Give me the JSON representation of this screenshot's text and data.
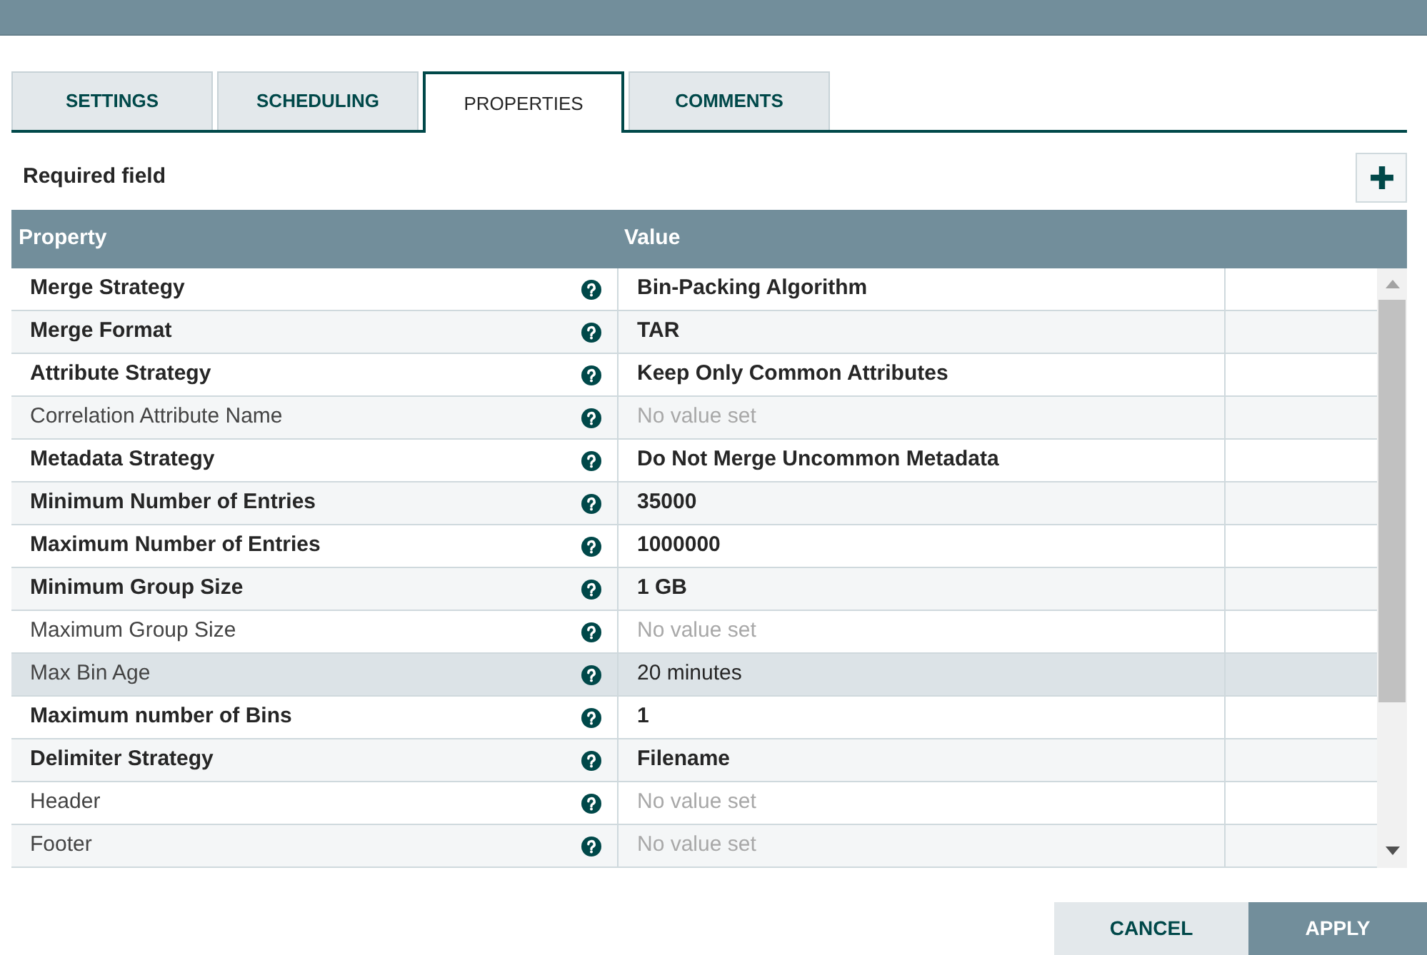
{
  "tabs": [
    {
      "label": "SETTINGS",
      "selected": false
    },
    {
      "label": "SCHEDULING",
      "selected": false
    },
    {
      "label": "PROPERTIES",
      "selected": true
    },
    {
      "label": "COMMENTS",
      "selected": false
    }
  ],
  "required_note": "Required field",
  "table": {
    "columns": [
      "Property",
      "Value"
    ],
    "rows": [
      {
        "property": "Merge Strategy",
        "required": true,
        "value": "Bin-Packing Algorithm",
        "value_set": true,
        "selected": false
      },
      {
        "property": "Merge Format",
        "required": true,
        "value": "TAR",
        "value_set": true,
        "selected": false
      },
      {
        "property": "Attribute Strategy",
        "required": true,
        "value": "Keep Only Common Attributes",
        "value_set": true,
        "selected": false
      },
      {
        "property": "Correlation Attribute Name",
        "required": false,
        "value": "No value set",
        "value_set": false,
        "selected": false
      },
      {
        "property": "Metadata Strategy",
        "required": true,
        "value": "Do Not Merge Uncommon Metadata",
        "value_set": true,
        "selected": false
      },
      {
        "property": "Minimum Number of Entries",
        "required": true,
        "value": "35000",
        "value_set": true,
        "selected": false
      },
      {
        "property": "Maximum Number of Entries",
        "required": true,
        "value": "1000000",
        "value_set": true,
        "selected": false
      },
      {
        "property": "Minimum Group Size",
        "required": true,
        "value": "1 GB",
        "value_set": true,
        "selected": false
      },
      {
        "property": "Maximum Group Size",
        "required": false,
        "value": "No value set",
        "value_set": false,
        "selected": false
      },
      {
        "property": "Max Bin Age",
        "required": false,
        "value": "20 minutes",
        "value_set": true,
        "selected": true
      },
      {
        "property": "Maximum number of Bins",
        "required": true,
        "value": "1",
        "value_set": true,
        "selected": false
      },
      {
        "property": "Delimiter Strategy",
        "required": true,
        "value": "Filename",
        "value_set": true,
        "selected": false
      },
      {
        "property": "Header",
        "required": false,
        "value": "No value set",
        "value_set": false,
        "selected": false
      },
      {
        "property": "Footer",
        "required": false,
        "value": "No value set",
        "value_set": false,
        "selected": false
      }
    ]
  },
  "buttons": [
    {
      "label": "CANCEL",
      "kind": "secondary"
    },
    {
      "label": "APPLY",
      "kind": "primary"
    }
  ]
}
